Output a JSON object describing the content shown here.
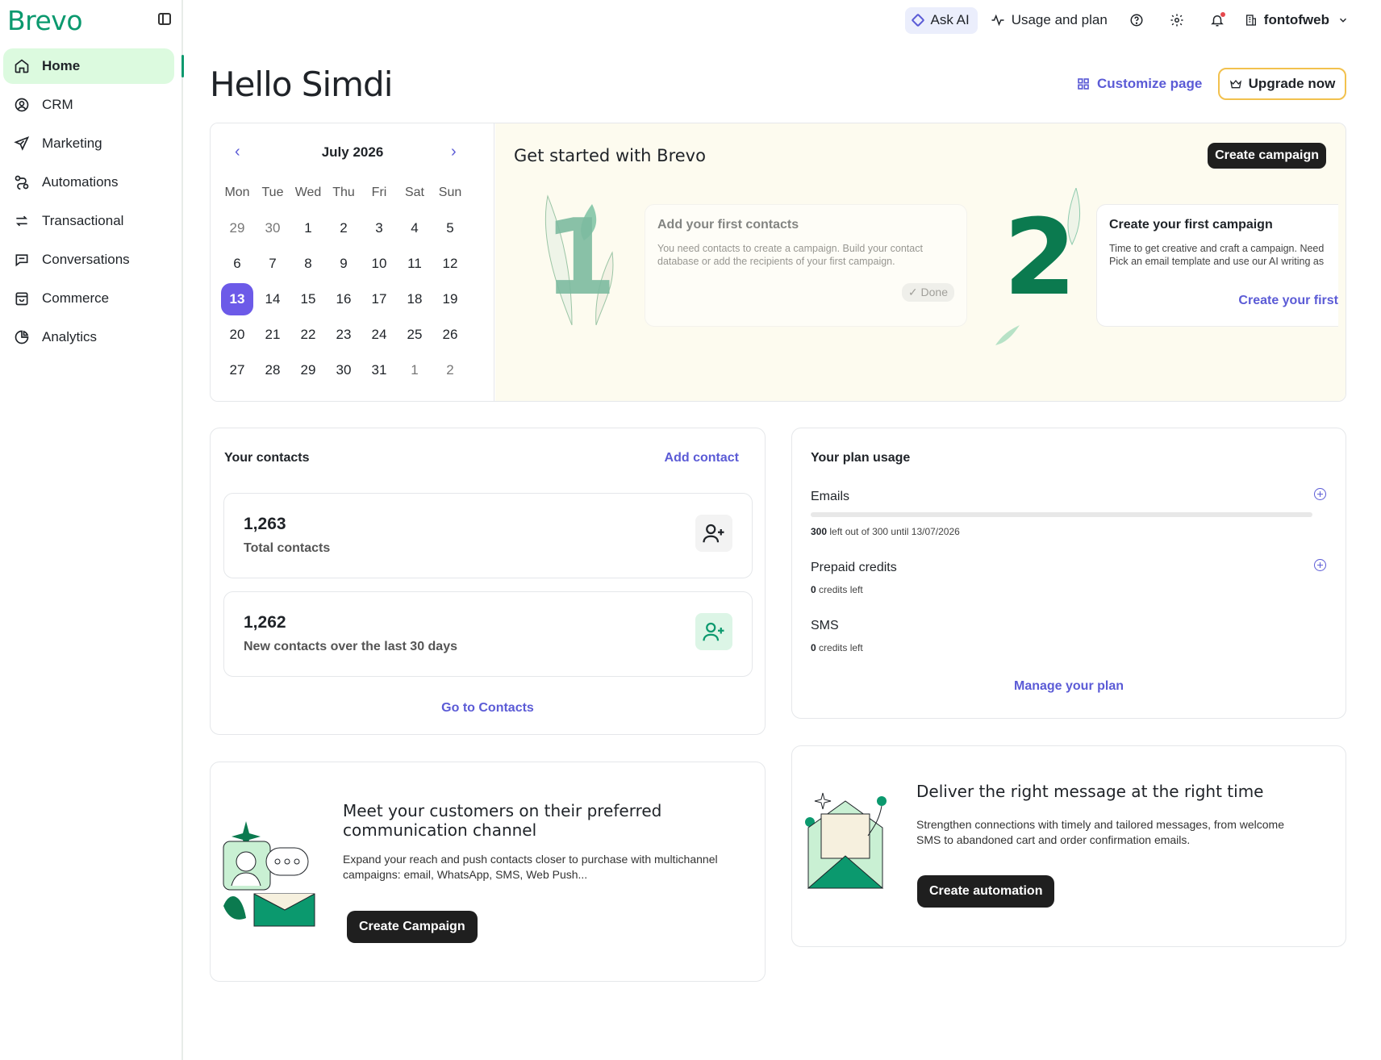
{
  "brand": {
    "logo": "Brevo",
    "accent": "#0b996e",
    "link_color": "#5b5bd6"
  },
  "sidebar": {
    "items": [
      {
        "label": "Home",
        "icon": "home-icon"
      },
      {
        "label": "CRM",
        "icon": "contacts-icon"
      },
      {
        "label": "Marketing",
        "icon": "send-icon"
      },
      {
        "label": "Automations",
        "icon": "automation-icon"
      },
      {
        "label": "Transactional",
        "icon": "transfer-icon"
      },
      {
        "label": "Conversations",
        "icon": "chat-icon"
      },
      {
        "label": "Commerce",
        "icon": "shopping-bag-icon"
      },
      {
        "label": "Analytics",
        "icon": "pie-chart-icon"
      }
    ]
  },
  "topbar": {
    "ask_ai": "Ask AI",
    "usage": "Usage and plan",
    "account": "fontofweb"
  },
  "header": {
    "greeting": "Hello Simdi",
    "customize": "Customize page",
    "upgrade": "Upgrade now"
  },
  "calendar": {
    "month": "July 2026",
    "weekdays": [
      "Mon",
      "Tue",
      "Wed",
      "Thu",
      "Fri",
      "Sat",
      "Sun"
    ],
    "selected_day": "13"
  },
  "get_started": {
    "title": "Get started with Brevo",
    "button": "Create campaign",
    "step1": {
      "number": "1",
      "title": "Add your first contacts",
      "desc_line1": "You need contacts to create a campaign. Build your contact",
      "desc_line2": "database or add the recipients of your first campaign.",
      "badge": "Done"
    },
    "step2": {
      "number": "2",
      "title": "Create your first campaign",
      "desc_line1": "Time to get creative and craft a campaign. Need",
      "desc_line2": "Pick an email template and use our AI writing as",
      "link": "Create your first"
    }
  },
  "contacts": {
    "title": "Your contacts",
    "add": "Add contact",
    "total_value": "1,263",
    "total_label": "Total contacts",
    "new_value": "1,262",
    "new_label": "New contacts over the last 30 days",
    "link": "Go to Contacts"
  },
  "plan": {
    "title": "Your plan usage",
    "emails_label": "Emails",
    "emails_left": "300",
    "emails_rest": " left out of 300 until 13/07/2026",
    "emails_used_fraction": 0,
    "prepaid_label": "Prepaid credits",
    "prepaid_value": "0",
    "prepaid_rest": " credits left",
    "sms_label": "SMS",
    "sms_value": "0",
    "sms_rest": " credits left",
    "manage": "Manage your plan"
  },
  "promo_channel": {
    "title_line1": "Meet your customers on their preferred",
    "title_line2": "communication channel",
    "desc_line1": "Expand your reach and push contacts closer to purchase with multichannel",
    "desc_line2": "campaigns: email, WhatsApp, SMS, Web Push...",
    "button": "Create Campaign"
  },
  "promo_automation": {
    "title": "Deliver the right message at the right time",
    "desc_line1": "Strengthen connections with timely and tailored messages, from welcome",
    "desc_line2": "SMS to abandoned cart and order confirmation emails.",
    "button": "Create automation"
  }
}
